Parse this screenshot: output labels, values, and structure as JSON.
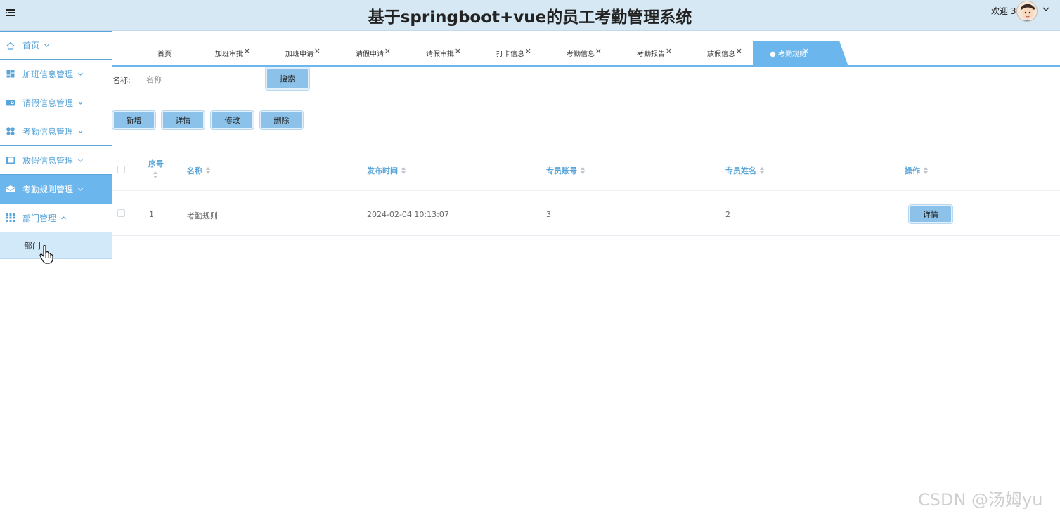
{
  "header": {
    "title": "基于springboot+vue的员工考勤管理系统",
    "welcome": "欢迎 3"
  },
  "sidebar": {
    "items": [
      {
        "label": "首页",
        "icon": "home-icon"
      },
      {
        "label": "加班信息管理",
        "icon": "dashboard-icon"
      },
      {
        "label": "请假信息管理",
        "icon": "wallet-icon"
      },
      {
        "label": "考勤信息管理",
        "icon": "grid-dots-icon"
      },
      {
        "label": "放假信息管理",
        "icon": "panel-icon"
      },
      {
        "label": "考勤规则管理",
        "icon": "mail-icon"
      },
      {
        "label": "部门管理",
        "icon": "apps-icon"
      }
    ],
    "submenu": [
      {
        "label": "部门"
      }
    ]
  },
  "tabs": [
    {
      "label": "首页"
    },
    {
      "label": "加班审批"
    },
    {
      "label": "加班申请"
    },
    {
      "label": "请假申请"
    },
    {
      "label": "请假审批"
    },
    {
      "label": "打卡信息"
    },
    {
      "label": "考勤信息"
    },
    {
      "label": "考勤报告"
    },
    {
      "label": "放假信息"
    },
    {
      "label": "● 考勤规则"
    }
  ],
  "tab_close_glyph": "×",
  "search": {
    "label": "名称:",
    "placeholder": "名称",
    "button": "搜索"
  },
  "actions": {
    "add": "新增",
    "detail": "详情",
    "edit": "修改",
    "delete": "删除"
  },
  "table": {
    "headers": [
      "序号",
      "名称",
      "发布时间",
      "专员账号",
      "专员姓名",
      "操作"
    ],
    "rows": [
      {
        "index": "1",
        "name": "考勤规则",
        "time": "2024-02-04 10:13:07",
        "account": "3",
        "staff_name": "2",
        "op": "详情"
      }
    ]
  },
  "watermark": "CSDN @汤姆yu",
  "colors": {
    "header_bg": "#d7e8f5",
    "accent": "#6cb6ee",
    "button": "#8cc2e9",
    "link_blue": "#5aa5d8",
    "submenu_bg": "#d2e9f9"
  }
}
